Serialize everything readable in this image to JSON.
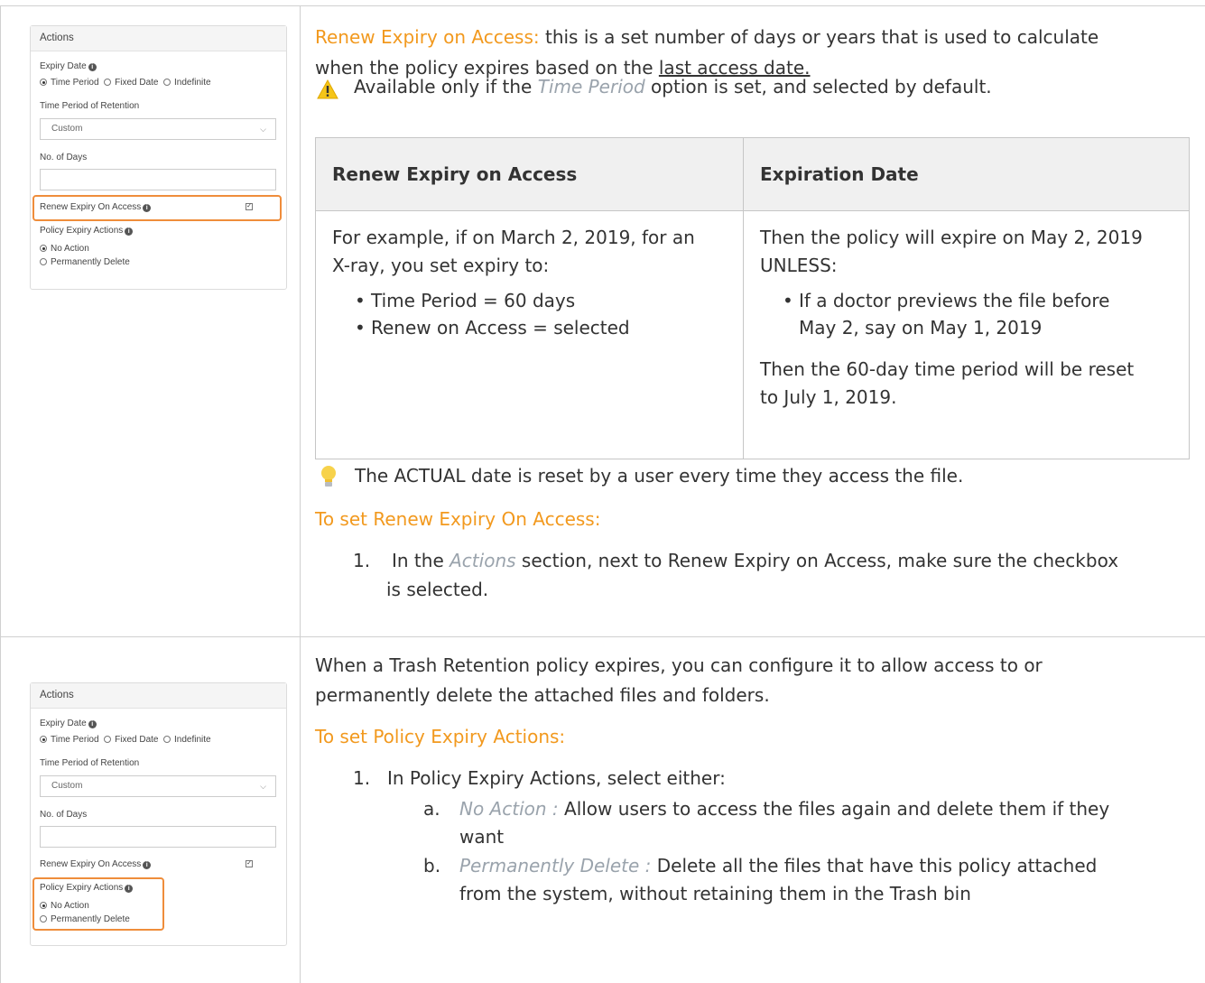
{
  "panel": {
    "title": "Actions",
    "expiry_date_label": "Expiry Date",
    "radio_time_period": "Time Period",
    "radio_fixed_date": "Fixed Date",
    "radio_indefinite": "Indefinite",
    "retention_label": "Time Period of Retention",
    "retention_value": "Custom",
    "days_label": "No. of Days",
    "renew_label": "Renew Expiry On Access",
    "renew_checked": true,
    "policy_actions_label": "Policy Expiry Actions",
    "radio_no_action": "No Action",
    "radio_perm_delete": "Permanently Delete"
  },
  "section1": {
    "term": "Renew Expiry on Access:",
    "desc_a": "this is a set number of days or years that is used to calculate",
    "desc_b": "when the policy expires based on the",
    "desc_link": "last access date.",
    "warn_a": "Available only if the",
    "warn_italic": "Time Period",
    "warn_b": "option is set, and selected by default.",
    "table": {
      "col1": "Renew Expiry on Access",
      "col2": "Expiration Date",
      "left_intro_1": "For example, if on March 2, 2019, for an",
      "left_intro_2": "X-ray, you set expiry to:",
      "left_b1": "Time Period = 60 days",
      "left_b2": "Renew on Access = selected",
      "right_1": "Then the policy will expire on May 2, 2019",
      "right_2": "UNLESS:",
      "right_b1a": "If a doctor previews the file before",
      "right_b1b": "May 2, say on May 1, 2019",
      "right_3": "Then the 60-day time period will be reset",
      "right_4": "to July 1, 2019."
    },
    "tip": "The ACTUAL date is reset by a user every time they access the file.",
    "howto_heading": "To set Renew Expiry On Access:",
    "step1_num": "1.",
    "step1_a": "In the",
    "step1_italic": "Actions",
    "step1_b": "section, next to Renew Expiry on Access, make sure the checkbox",
    "step1_c": "is selected."
  },
  "section2": {
    "intro_1": "When a Trash Retention policy expires, you can configure it to allow access to or",
    "intro_2": "permanently delete the attached files and folders.",
    "howto_heading": "To set Policy Expiry Actions:",
    "step1_num": "1.",
    "step1": "In Policy Expiry Actions, select either:",
    "a_num": "a.",
    "a_term": "No Action",
    "a_sep": ":",
    "a_text_1": "Allow users to access the files again and delete them if they",
    "a_text_2": "want",
    "b_num": "b.",
    "b_term": "Permanently Delete :",
    "b_text_1": "Delete all the files that have this policy attached",
    "b_text_2": "from the system, without retaining them in the Trash bin"
  },
  "colors": {
    "accent_orange": "#f2991e",
    "highlight_border": "#ef8d3b",
    "muted_italic": "#9aa3ac"
  }
}
